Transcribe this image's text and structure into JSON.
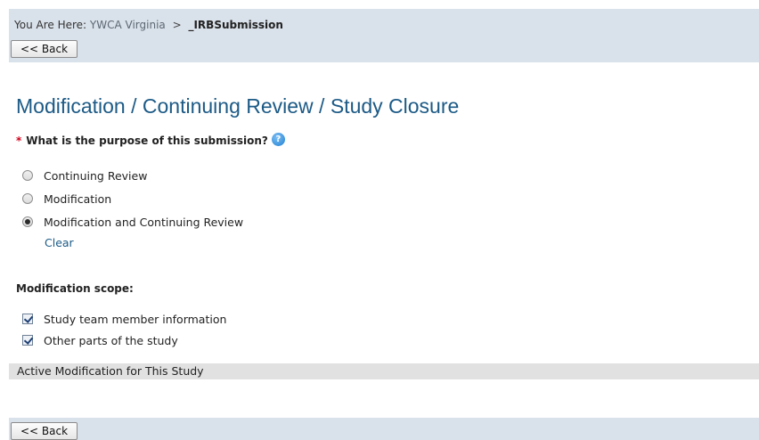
{
  "breadcrumb": {
    "prefix": "You Are Here:",
    "parent": "YWCA Virginia",
    "separator": ">",
    "current": "_IRBSubmission"
  },
  "back_button_label": "<< Back",
  "page_title": "Modification / Continuing Review / Study Closure",
  "purpose": {
    "required_marker": "*",
    "question": "What is the purpose of this submission?",
    "help_icon": "?",
    "options": [
      {
        "label": "Continuing Review",
        "selected": false
      },
      {
        "label": "Modification",
        "selected": false
      },
      {
        "label": "Modification and Continuing Review",
        "selected": true
      }
    ],
    "clear_label": "Clear"
  },
  "scope": {
    "label": "Modification scope:",
    "options": [
      {
        "label": "Study team member information",
        "checked": true
      },
      {
        "label": "Other parts of the study",
        "checked": true
      }
    ]
  },
  "active_section_label": "Active Modification for This Study",
  "colors": {
    "header_bar": "#d9e1ea",
    "title": "#1c5a86",
    "required": "#d0021b",
    "section_header": "#e1e1e1"
  }
}
